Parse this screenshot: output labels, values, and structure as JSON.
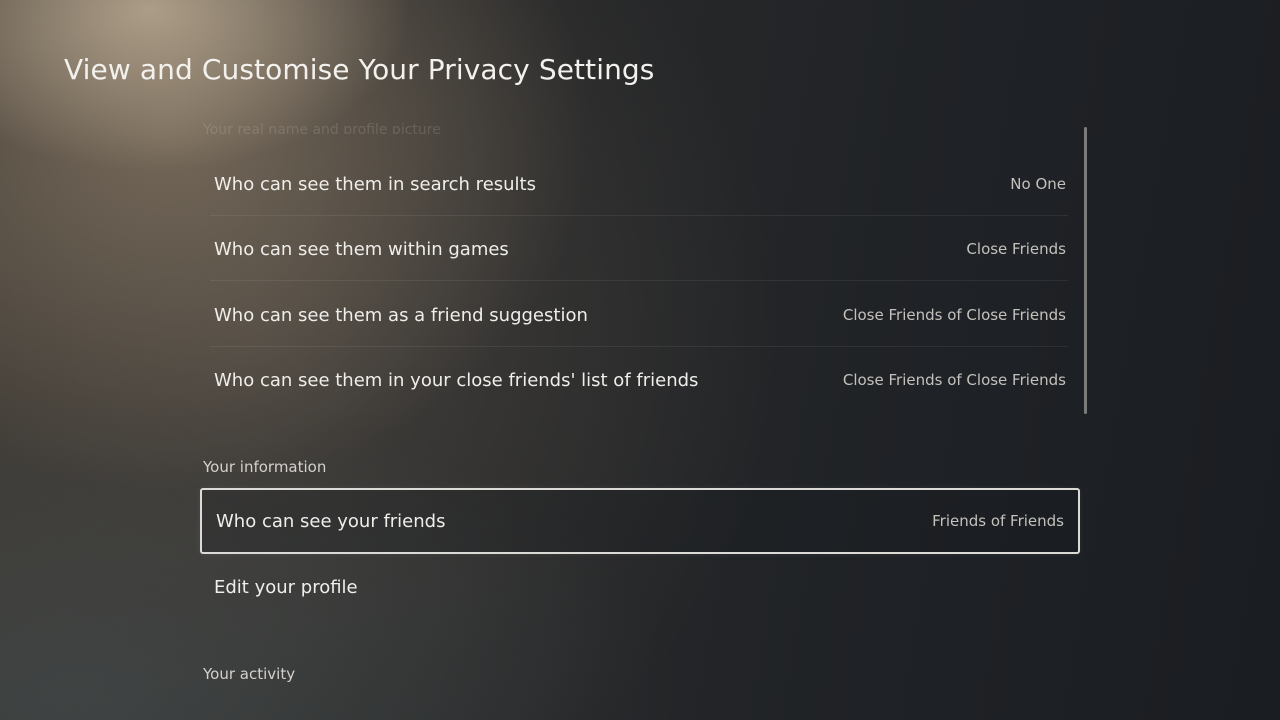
{
  "page": {
    "title": "View and Customise Your Privacy Settings"
  },
  "sections": {
    "real_name": {
      "header": "Your real name and profile picture",
      "rows": [
        {
          "label": "Who can see them in search results",
          "value": "No One"
        },
        {
          "label": "Who can see them within games",
          "value": "Close Friends"
        },
        {
          "label": "Who can see them as a friend suggestion",
          "value": "Close Friends of Close Friends"
        },
        {
          "label": "Who can see them in your close friends' list of friends",
          "value": "Close Friends of Close Friends"
        }
      ]
    },
    "your_information": {
      "header": "Your information",
      "rows": [
        {
          "label": "Who can see your friends",
          "value": "Friends of Friends",
          "focused": true
        },
        {
          "label": "Edit your profile",
          "value": ""
        }
      ]
    },
    "your_activity": {
      "header": "Your activity"
    }
  }
}
